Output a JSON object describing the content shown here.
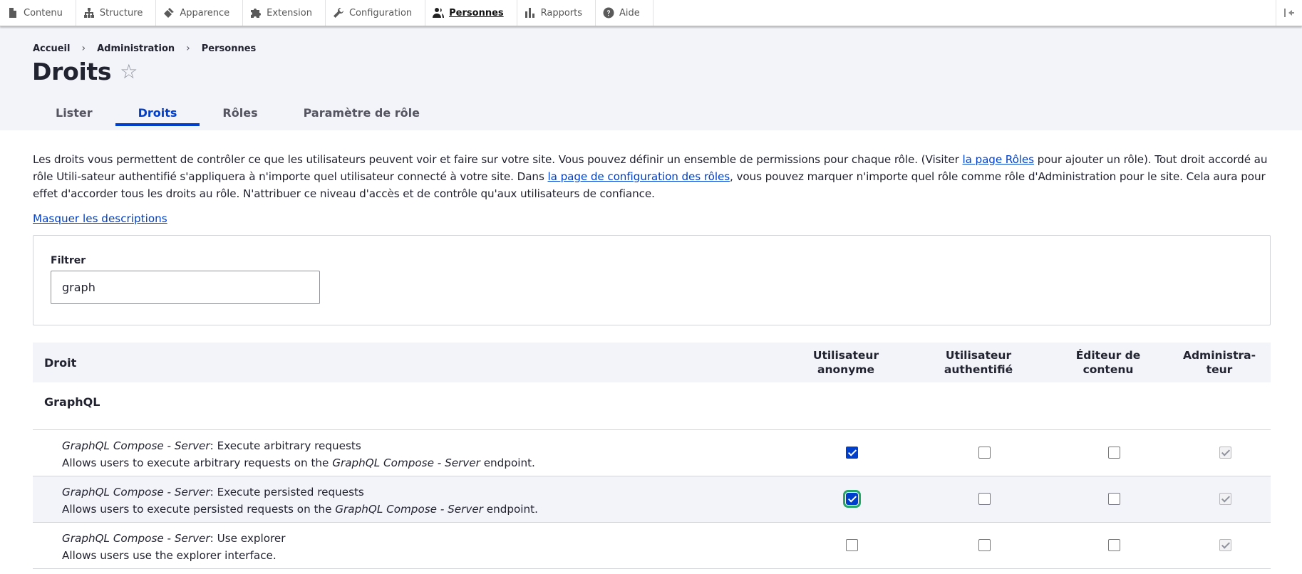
{
  "toolbar": {
    "items": [
      {
        "label": "Contenu",
        "icon": "file-icon"
      },
      {
        "label": "Structure",
        "icon": "sitemap-icon"
      },
      {
        "label": "Apparence",
        "icon": "brush-icon"
      },
      {
        "label": "Extension",
        "icon": "puzzle-icon"
      },
      {
        "label": "Configuration",
        "icon": "wrench-icon"
      },
      {
        "label": "Personnes",
        "icon": "people-icon"
      },
      {
        "label": "Rapports",
        "icon": "chart-icon"
      },
      {
        "label": "Aide",
        "icon": "help-icon"
      }
    ],
    "active": "Personnes"
  },
  "breadcrumb": [
    "Accueil",
    "Administration",
    "Personnes"
  ],
  "page_title": "Droits",
  "tabs": [
    {
      "label": "Lister"
    },
    {
      "label": "Droits"
    },
    {
      "label": "Rôles"
    },
    {
      "label": "Paramètre de rôle"
    }
  ],
  "active_tab": "Droits",
  "intro": {
    "part1": "Les droits vous permettent de contrôler ce que les utilisateurs peuvent voir et faire sur votre site. Vous pouvez définir un ensemble de permissions pour chaque rôle. (Visiter ",
    "link1": "la page Rôles",
    "part2": " pour ajouter un rôle). Tout droit accordé au rôle Utili-sateur authentifié s'appliquera à n'importe quel utilisateur connecté à votre site. Dans ",
    "link2": "la page de configuration des rôles",
    "part3": ", vous pouvez marquer n'importe quel rôle comme rôle d'Administration pour le site. Cela aura pour effet d'accorder tous les droits au rôle. N'attribuer ce niveau d'accès et de contrôle qu'aux utilisateurs de confiance."
  },
  "hide_descriptions": "Masquer les descriptions",
  "filter": {
    "label": "Filtrer",
    "value": "graph"
  },
  "table": {
    "header_droit": "Droit",
    "roles": [
      {
        "line1": "Utilisateur",
        "line2": "anonyme"
      },
      {
        "line1": "Utilisateur",
        "line2": "authentifié"
      },
      {
        "line1": "Éditeur de",
        "line2": "contenu"
      },
      {
        "line1": "Administra-",
        "line2": "teur"
      }
    ],
    "group": "GraphQL",
    "rows": [
      {
        "server": "GraphQL Compose - Server",
        "title": ": Execute arbitrary requests",
        "desc_pre": "Allows users to execute arbitrary requests on the ",
        "desc_em": "GraphQL Compose - Server",
        "desc_post": " endpoint.",
        "checks": [
          true,
          false,
          false,
          true
        ]
      },
      {
        "server": "GraphQL Compose - Server",
        "title": ": Execute persisted requests",
        "desc_pre": "Allows users to execute persisted requests on the ",
        "desc_em": "GraphQL Compose - Server",
        "desc_post": " endpoint.",
        "checks": [
          true,
          false,
          false,
          true
        ]
      },
      {
        "server": "GraphQL Compose - Server",
        "title": ": Use explorer",
        "desc_pre": "Allows users use the explorer interface.",
        "desc_em": "",
        "desc_post": "",
        "checks": [
          false,
          false,
          false,
          true
        ]
      }
    ]
  }
}
